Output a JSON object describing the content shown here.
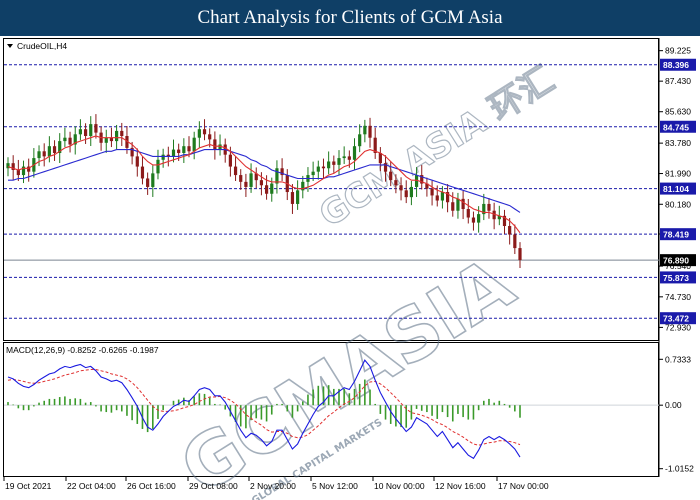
{
  "title": "Chart Analysis for Clients of GCM Asia",
  "colors": {
    "header_bg": "#0f3f66",
    "bull": "#1e7a1e",
    "bear": "#8b1a1a",
    "ma_fast": "#e03030",
    "ma_slow": "#2a2ad0",
    "level_line": "#1a1aaa",
    "level_box": "#1a1aaa",
    "price_box": "#000000",
    "macd_hist": "#3a9a2a",
    "macd_signal": "#e03030",
    "macd_line": "#1a1ae0",
    "watermark": "#5a6e84"
  },
  "watermark": {
    "text1": "GCMASIA",
    "text2": "GCM ASIA 环汇",
    "text3": "GLOBAL CAPITAL MARKETS"
  },
  "chart_data": [
    {
      "type": "candlestick",
      "symbol_label": "CrudeOIL,H4",
      "y_ticks": [
        "89.225",
        "87.430",
        "85.630",
        "83.780",
        "81.990",
        "80.180",
        "78.430",
        "76.540",
        "74.730",
        "72.930"
      ],
      "ylim": [
        72.6,
        89.5
      ],
      "levels": [
        {
          "value": "88.396"
        },
        {
          "value": "84.745"
        },
        {
          "value": "81.104"
        },
        {
          "value": "78.419"
        },
        {
          "value": "75.873"
        },
        {
          "value": "73.472"
        }
      ],
      "current_price": "76.890",
      "x_ticks": [
        "19 Oct 2021",
        "22 Oct 04:00",
        "26 Oct 16:00",
        "29 Oct 08:00",
        "2 Nov 20:00",
        "5 Nov 12:00",
        "10 Nov 00:00",
        "12 Nov 16:00",
        "17 Nov 00:00"
      ],
      "close": [
        82.6,
        82.2,
        81.9,
        82.4,
        82.1,
        82.9,
        83.3,
        83.0,
        83.6,
        83.2,
        83.9,
        84.1,
        83.7,
        84.3,
        84.6,
        84.2,
        84.9,
        84.4,
        83.8,
        84.1,
        83.9,
        84.5,
        84.2,
        83.5,
        83.0,
        82.4,
        81.7,
        81.2,
        82.0,
        82.8,
        83.1,
        83.0,
        83.4,
        83.2,
        83.6,
        83.3,
        84.1,
        84.6,
        84.3,
        84.0,
        83.4,
        83.7,
        83.1,
        82.4,
        81.9,
        81.5,
        81.2,
        82.0,
        81.6,
        81.3,
        80.8,
        81.4,
        82.3,
        81.9,
        80.9,
        80.2,
        81.0,
        81.5,
        81.9,
        82.1,
        82.4,
        82.3,
        82.7,
        82.5,
        82.9,
        83.0,
        82.8,
        83.6,
        84.3,
        84.8,
        84.1,
        83.2,
        82.6,
        82.1,
        81.6,
        81.3,
        81.0,
        80.6,
        81.2,
        81.9,
        81.4,
        81.1,
        80.7,
        80.4,
        80.9,
        80.3,
        79.8,
        80.5,
        79.9,
        79.4,
        79.1,
        79.6,
        80.2,
        79.8,
        79.3,
        79.5,
        78.9,
        78.4,
        77.6,
        76.9
      ],
      "ma_fast": [
        82.4,
        82.3,
        82.2,
        82.3,
        82.3,
        82.5,
        82.7,
        82.8,
        83.0,
        83.1,
        83.3,
        83.5,
        83.6,
        83.8,
        83.9,
        84.0,
        84.1,
        84.2,
        84.1,
        84.1,
        84.1,
        84.1,
        84.1,
        83.9,
        83.7,
        83.4,
        83.0,
        82.7,
        82.5,
        82.5,
        82.6,
        82.7,
        82.8,
        82.9,
        83.0,
        83.1,
        83.3,
        83.5,
        83.6,
        83.7,
        83.6,
        83.6,
        83.5,
        83.3,
        83.0,
        82.7,
        82.4,
        82.2,
        82.0,
        81.8,
        81.6,
        81.5,
        81.5,
        81.5,
        81.4,
        81.2,
        81.1,
        81.1,
        81.2,
        81.3,
        81.5,
        81.7,
        81.9,
        82.0,
        82.2,
        82.4,
        82.5,
        82.7,
        83.0,
        83.3,
        83.4,
        83.3,
        83.2,
        83.0,
        82.7,
        82.4,
        82.1,
        81.8,
        81.6,
        81.6,
        81.5,
        81.4,
        81.2,
        81.0,
        80.9,
        80.8,
        80.6,
        80.5,
        80.3,
        80.1,
        79.9,
        79.8,
        79.7,
        79.7,
        79.6,
        79.5,
        79.4,
        79.2,
        78.9,
        78.5
      ],
      "ma_slow": [
        81.6,
        81.6,
        81.7,
        81.7,
        81.8,
        81.9,
        82.0,
        82.1,
        82.2,
        82.3,
        82.4,
        82.5,
        82.6,
        82.7,
        82.8,
        82.9,
        83.0,
        83.1,
        83.2,
        83.3,
        83.3,
        83.4,
        83.4,
        83.4,
        83.4,
        83.3,
        83.2,
        83.1,
        83.0,
        83.0,
        83.0,
        83.0,
        83.0,
        83.0,
        83.1,
        83.1,
        83.2,
        83.3,
        83.4,
        83.4,
        83.4,
        83.4,
        83.4,
        83.3,
        83.2,
        83.1,
        83.0,
        82.8,
        82.7,
        82.5,
        82.4,
        82.2,
        82.1,
        82.0,
        81.9,
        81.8,
        81.7,
        81.7,
        81.7,
        81.7,
        81.7,
        81.7,
        81.8,
        81.8,
        81.9,
        82.0,
        82.1,
        82.2,
        82.3,
        82.4,
        82.5,
        82.5,
        82.5,
        82.5,
        82.4,
        82.3,
        82.2,
        82.1,
        82.0,
        81.9,
        81.8,
        81.7,
        81.6,
        81.5,
        81.4,
        81.3,
        81.2,
        81.1,
        81.0,
        80.9,
        80.8,
        80.7,
        80.6,
        80.5,
        80.4,
        80.3,
        80.2,
        80.1,
        79.9,
        79.7
      ]
    },
    {
      "type": "macd",
      "label": "MACD(12,26,9) -0.8252 -0.6265 -0.1987",
      "y_ticks": [
        "0.7333",
        "0.00",
        "-1.0152"
      ],
      "ylim": [
        -1.1,
        0.85
      ],
      "macd": [
        0.45,
        0.42,
        0.35,
        0.3,
        0.28,
        0.33,
        0.4,
        0.45,
        0.5,
        0.52,
        0.58,
        0.62,
        0.6,
        0.63,
        0.65,
        0.6,
        0.62,
        0.55,
        0.45,
        0.42,
        0.38,
        0.4,
        0.36,
        0.25,
        0.12,
        -0.02,
        -0.2,
        -0.35,
        -0.4,
        -0.3,
        -0.18,
        -0.1,
        -0.02,
        0.02,
        0.08,
        0.06,
        0.15,
        0.25,
        0.28,
        0.25,
        0.15,
        0.15,
        0.05,
        -0.1,
        -0.25,
        -0.4,
        -0.52,
        -0.45,
        -0.48,
        -0.55,
        -0.65,
        -0.58,
        -0.4,
        -0.4,
        -0.55,
        -0.7,
        -0.62,
        -0.45,
        -0.3,
        -0.15,
        -0.02,
        0.05,
        0.15,
        0.15,
        0.22,
        0.28,
        0.25,
        0.38,
        0.55,
        0.72,
        0.62,
        0.4,
        0.2,
        0.05,
        -0.1,
        -0.22,
        -0.32,
        -0.42,
        -0.35,
        -0.2,
        -0.25,
        -0.3,
        -0.4,
        -0.5,
        -0.42,
        -0.55,
        -0.68,
        -0.6,
        -0.7,
        -0.8,
        -0.85,
        -0.72,
        -0.55,
        -0.5,
        -0.55,
        -0.5,
        -0.55,
        -0.62,
        -0.7,
        -0.83
      ],
      "signal": [
        0.4,
        0.41,
        0.4,
        0.38,
        0.36,
        0.35,
        0.36,
        0.38,
        0.4,
        0.42,
        0.45,
        0.48,
        0.5,
        0.52,
        0.55,
        0.56,
        0.57,
        0.57,
        0.55,
        0.53,
        0.5,
        0.48,
        0.46,
        0.42,
        0.36,
        0.28,
        0.18,
        0.08,
        -0.02,
        -0.08,
        -0.1,
        -0.1,
        -0.09,
        -0.07,
        -0.04,
        -0.02,
        0.01,
        0.06,
        0.1,
        0.13,
        0.13,
        0.14,
        0.12,
        0.08,
        0.02,
        -0.06,
        -0.15,
        -0.21,
        -0.27,
        -0.32,
        -0.39,
        -0.43,
        -0.42,
        -0.42,
        -0.45,
        -0.5,
        -0.52,
        -0.51,
        -0.47,
        -0.4,
        -0.33,
        -0.25,
        -0.17,
        -0.11,
        -0.04,
        0.02,
        0.06,
        0.12,
        0.21,
        0.31,
        0.37,
        0.38,
        0.34,
        0.28,
        0.2,
        0.12,
        0.03,
        -0.06,
        -0.12,
        -0.14,
        -0.16,
        -0.19,
        -0.23,
        -0.28,
        -0.31,
        -0.36,
        -0.42,
        -0.46,
        -0.51,
        -0.57,
        -0.62,
        -0.64,
        -0.62,
        -0.6,
        -0.59,
        -0.57,
        -0.57,
        -0.58,
        -0.6,
        -0.63
      ]
    }
  ]
}
